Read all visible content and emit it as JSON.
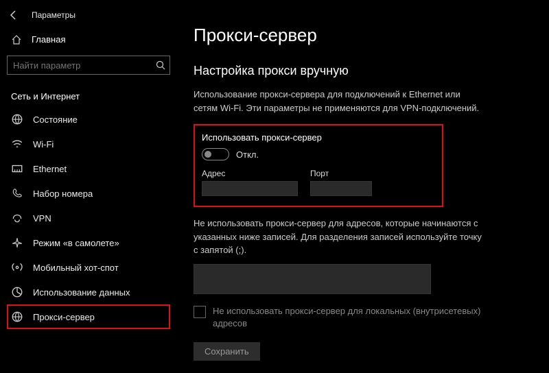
{
  "app": {
    "title": "Параметры"
  },
  "search": {
    "placeholder": "Найти параметр"
  },
  "home": {
    "label": "Главная"
  },
  "category": {
    "label": "Сеть и Интернет"
  },
  "nav": {
    "items": [
      {
        "label": "Состояние"
      },
      {
        "label": "Wi-Fi"
      },
      {
        "label": "Ethernet"
      },
      {
        "label": "Набор номера"
      },
      {
        "label": "VPN"
      },
      {
        "label": "Режим «в самолете»"
      },
      {
        "label": "Мобильный хот-спот"
      },
      {
        "label": "Использование данных"
      },
      {
        "label": "Прокси-сервер"
      }
    ]
  },
  "page": {
    "title": "Прокси-сервер",
    "section_title": "Настройка прокси вручную",
    "section_desc": "Использование прокси-сервера для подключений к Ethernet или сетям Wi-Fi. Эти параметры не применяются для VPN-подключений.",
    "toggle_label": "Использовать прокси-сервер",
    "toggle_state": "Откл.",
    "address_label": "Адрес",
    "port_label": "Порт",
    "bypass_desc": "Не использовать прокси-сервер для адресов, которые начинаются с указанных ниже записей. Для разделения записей используйте точку с запятой (;).",
    "local_bypass_label": "Не использовать прокси-сервер для локальных (внутрисетевых) адресов",
    "save_label": "Сохранить"
  }
}
